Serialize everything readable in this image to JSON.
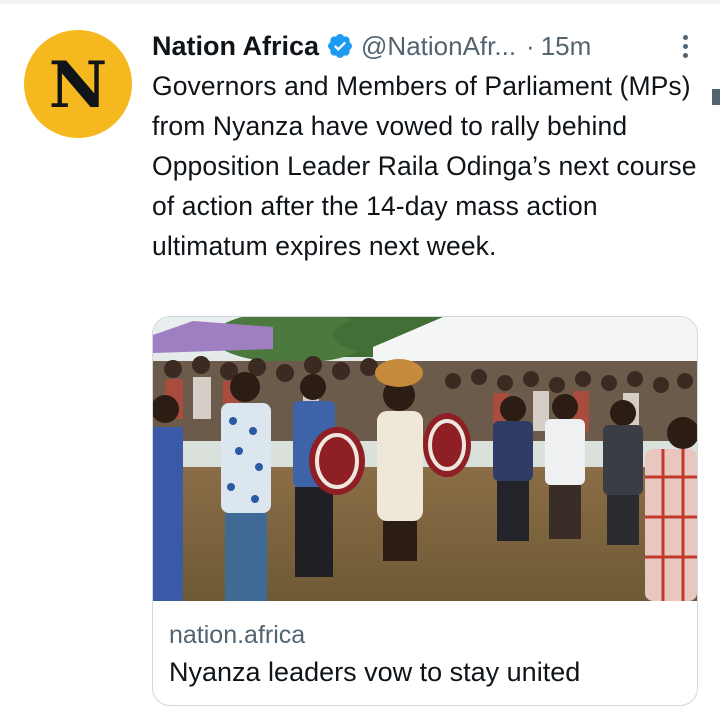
{
  "tweet": {
    "author_name": "Nation Africa",
    "avatar_letter": "N",
    "avatar_color": "#f5b81f",
    "verified_color": "#1d9bf0",
    "handle": "@NationAfr...",
    "separator": "·",
    "time": "15m",
    "text": "Governors and Members of Parliament (MPs) from Nyanza have vowed to rally behind Opposition Leader Raila Odinga’s next course of action after the 14-day mass action ultimatum expires next week."
  },
  "card": {
    "domain": "nation.africa",
    "title": "Nyanza leaders vow to stay united",
    "image_icon": "crowd-photo"
  },
  "icons": {
    "more": "more-vertical-icon",
    "verified": "verified-badge-icon"
  }
}
